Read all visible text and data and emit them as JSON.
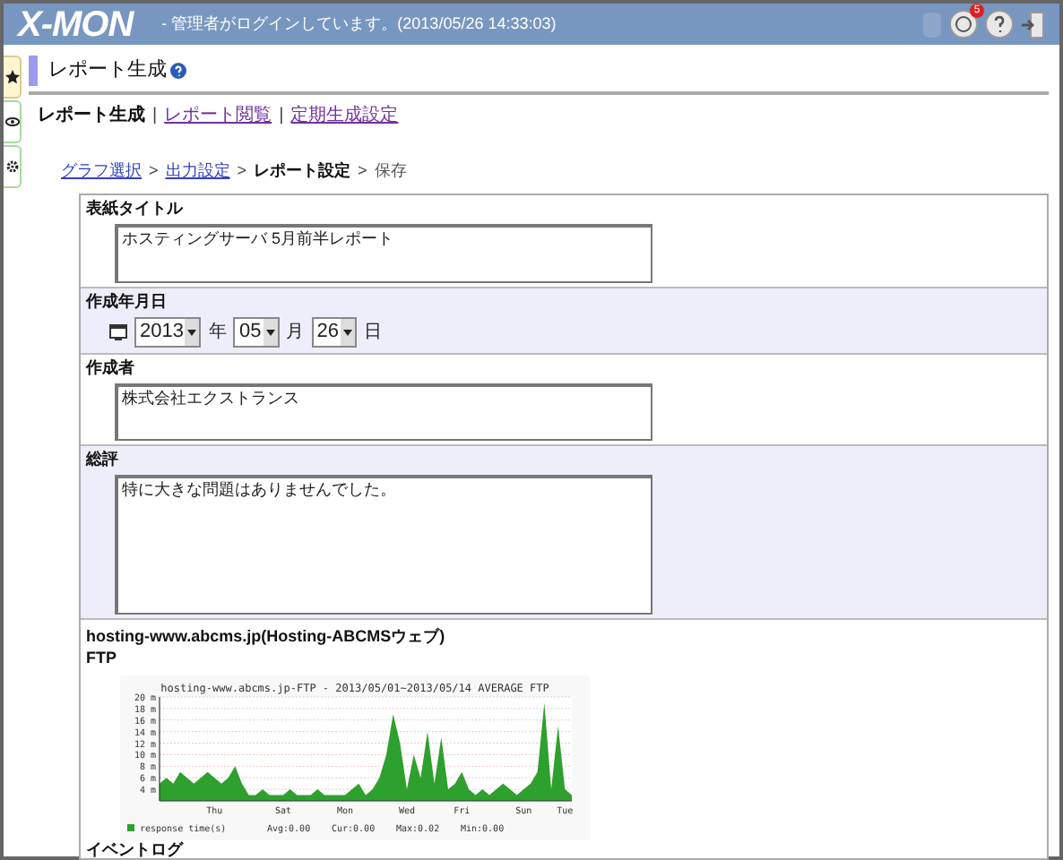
{
  "header": {
    "logo": "X-MON",
    "login_message": "- 管理者がログインしています。(2013/05/26 14:33:03)",
    "notification_badge": "5"
  },
  "side_tabs": [
    {
      "kind": "star",
      "selected": true
    },
    {
      "kind": "eye",
      "selected": false
    },
    {
      "kind": "gear",
      "selected": false
    }
  ],
  "page_title": "レポート生成",
  "subnav_separator": "|",
  "breadcrumb_separator": ">",
  "subnav": [
    {
      "label": "レポート生成",
      "selected": true
    },
    {
      "label": "レポート閲覧",
      "selected": false
    },
    {
      "label": "定期生成設定",
      "selected": false
    }
  ],
  "breadcrumb": [
    {
      "label": "グラフ選択",
      "kind": "link"
    },
    {
      "label": "出力設定",
      "kind": "link"
    },
    {
      "label": "レポート設定",
      "kind": "current"
    },
    {
      "label": "保存",
      "kind": "plain"
    }
  ],
  "form": {
    "cover_title": {
      "label": "表紙タイトル",
      "value": "ホスティングサーバ 5月前半レポート"
    },
    "date": {
      "label": "作成年月日",
      "year": "2013",
      "year_unit": "年",
      "month": "05",
      "month_unit": "月",
      "day": "26",
      "day_unit": "日"
    },
    "author": {
      "label": "作成者",
      "value": "株式会社エクストランス"
    },
    "summary": {
      "label": "総評",
      "value": "特に大きな問題はありませんでした。"
    }
  },
  "host": {
    "title": "hosting-www.abcms.jp(Hosting-ABCMSウェブ)",
    "service": "FTP",
    "chart_stats": [
      "Avg:0.00",
      "Cur:0.00",
      "Max:0.02",
      "Min:0.00"
    ],
    "chart_data": {
      "type": "area",
      "title": "hosting-www.abcms.jp-FTP - 2013/05/01~2013/05/14 AVERAGE  FTP",
      "categories": [
        null,
        null,
        null,
        null,
        null,
        null,
        null,
        null,
        "Thu",
        null,
        null,
        null,
        null,
        null,
        null,
        null,
        null,
        null,
        "Sat",
        null,
        null,
        null,
        null,
        null,
        null,
        null,
        null,
        "Mon",
        null,
        null,
        null,
        null,
        null,
        null,
        null,
        null,
        "Wed",
        null,
        null,
        null,
        null,
        null,
        null,
        null,
        "Fri",
        null,
        null,
        null,
        null,
        null,
        null,
        null,
        null,
        "Sun",
        null,
        null,
        null,
        null,
        null,
        "Tue",
        null
      ],
      "series": [
        {
          "name": "response time(s)",
          "color": "#2ea02e",
          "values": [
            5,
            6,
            5,
            7,
            6,
            5,
            6,
            7,
            6,
            5,
            6,
            8,
            5,
            3,
            3,
            4,
            3,
            3,
            3,
            4,
            3,
            3,
            3,
            4,
            3,
            3,
            3,
            3,
            4,
            5,
            3,
            4,
            6,
            10,
            17,
            12,
            4,
            10,
            6,
            14,
            5,
            13,
            4,
            5,
            7,
            4,
            3,
            4,
            3,
            4,
            5,
            4,
            3,
            4,
            5,
            7,
            19,
            4,
            15,
            4,
            3
          ]
        }
      ],
      "ylim": [
        2,
        20
      ],
      "yticks": [
        {
          "value": 20,
          "label": "20 m"
        },
        {
          "value": 18,
          "label": "18 m"
        },
        {
          "value": 16,
          "label": "16 m"
        },
        {
          "value": 14,
          "label": "14 m"
        },
        {
          "value": 12,
          "label": "12 m"
        },
        {
          "value": 10,
          "label": "10 m"
        },
        {
          "value": 8,
          "label": "8 m"
        },
        {
          "value": 6,
          "label": "6 m"
        },
        {
          "value": 4,
          "label": "4 m"
        }
      ],
      "grid": true
    },
    "next_section": "イベントログ"
  }
}
